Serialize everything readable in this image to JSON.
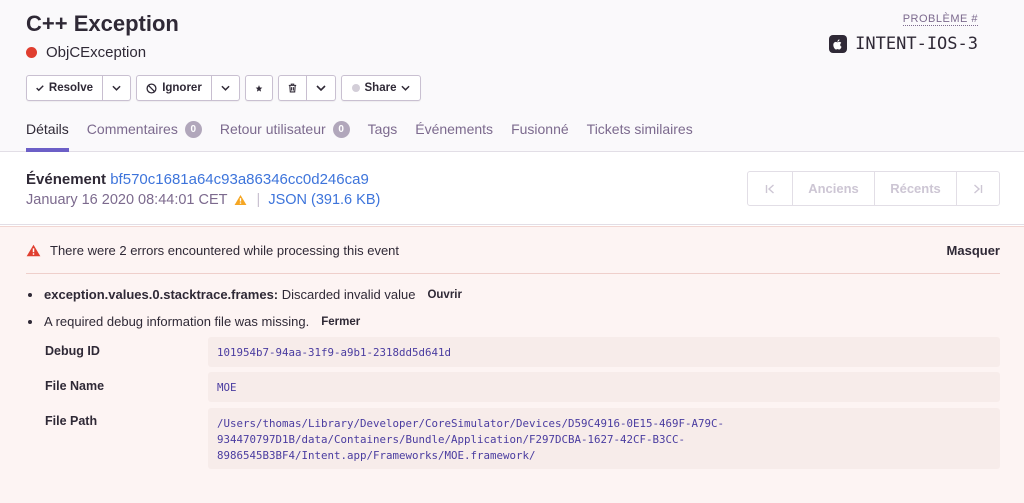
{
  "header": {
    "title": "C++ Exception",
    "subtitle": "ObjCException",
    "issue_label": "PROBLÈME #",
    "issue_id": "INTENT-IOS-3"
  },
  "toolbar": {
    "resolve": "Resolve",
    "ignore": "Ignorer",
    "share": "Share"
  },
  "tabs": [
    {
      "label": "Détails"
    },
    {
      "label": "Commentaires",
      "badge": "0"
    },
    {
      "label": "Retour utilisateur",
      "badge": "0"
    },
    {
      "label": "Tags"
    },
    {
      "label": "Événements"
    },
    {
      "label": "Fusionné"
    },
    {
      "label": "Tickets similaires"
    }
  ],
  "event": {
    "label": "Événement",
    "id": "bf570c1681a64c93a86346cc0d246ca9",
    "date": "January 16 2020 08:44:01 CET",
    "json": "JSON (391.6 KB)"
  },
  "pager": {
    "older": "Anciens",
    "newer": "Récents"
  },
  "errors": {
    "heading": "There were 2 errors encountered while processing this event",
    "hide": "Masquer",
    "items": [
      {
        "key": "exception.values.0.stacktrace.frames:",
        "text": "Discarded invalid value",
        "toggle": "Ouvrir"
      },
      {
        "text": "A required debug information file was missing.",
        "toggle": "Fermer"
      }
    ],
    "details": [
      {
        "key": "Debug ID",
        "value": "101954b7-94aa-31f9-a9b1-2318dd5d641d"
      },
      {
        "key": "File Name",
        "value": "MOE"
      },
      {
        "key": "File Path",
        "value_lines": [
          "/Users/thomas/Library/Developer/CoreSimulator/Devices/D59C4916-0E15-469F-A79C-",
          "934470797D1B/data/Containers/Bundle/Application/F297DCBA-1627-42CF-B3CC-",
          "8986545B3BF4/Intent.app/Frameworks/MOE.framework/"
        ]
      }
    ]
  },
  "colors": {
    "accent": "#6c5fc7",
    "link": "#3d74db",
    "error": "#e03e2f",
    "warning": "#f5a623"
  }
}
